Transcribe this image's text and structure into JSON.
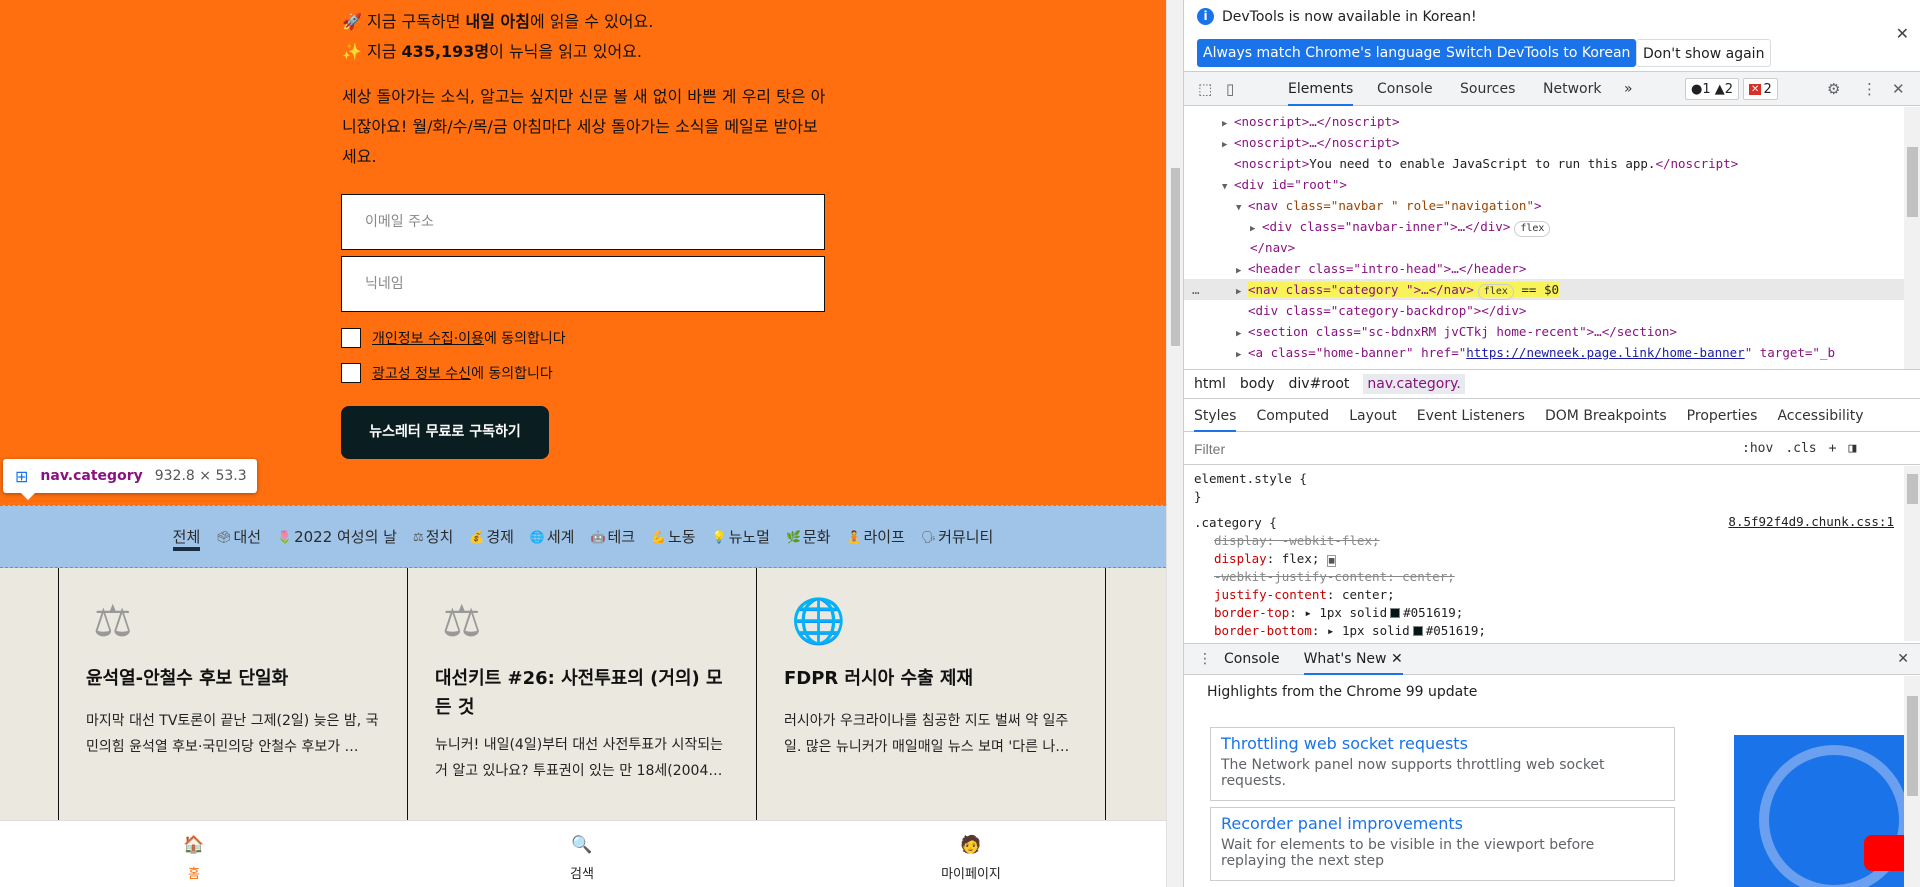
{
  "page": {
    "promo_line1_pre": "🚀 지금 구독하면 ",
    "promo_line1_bold": "내일 아침",
    "promo_line1_post": "에 읽을 수 있어요.",
    "promo_line2_pre": "✨ 지금 ",
    "promo_line2_bold": "435,193명",
    "promo_line2_post": "이 뉴닉을 읽고 있어요.",
    "description": "세상 돌아가는 소식, 알고는 싶지만 신문 볼 새 없이 바쁜 게 우리 탓은 아니잖아요! 월/화/수/목/금 아침마다 세상 돌아가는 소식을 메일로 받아보세요.",
    "email_placeholder": "이메일 주소",
    "nickname_placeholder": "닉네임",
    "consent1_link": "개인정보 수집·이용",
    "consent1_text": "에 동의합니다",
    "consent2_link": "광고성 정보 수신",
    "consent2_text": "에 동의합니다",
    "subscribe_button": "뉴스레터 무료로 구독하기",
    "inspect_tooltip": {
      "tag": "nav.category",
      "size": "932.8 × 53.3"
    },
    "categories": [
      {
        "icon": "",
        "label": "전체",
        "active": true
      },
      {
        "icon": "🗳",
        "label": "대선"
      },
      {
        "icon": "🌷",
        "label": "2022 여성의 날"
      },
      {
        "icon": "⚖",
        "label": "정치"
      },
      {
        "icon": "💰",
        "label": "경제"
      },
      {
        "icon": "🌐",
        "label": "세계"
      },
      {
        "icon": "🤖",
        "label": "테크"
      },
      {
        "icon": "💪",
        "label": "노동"
      },
      {
        "icon": "💡",
        "label": "뉴노멀"
      },
      {
        "icon": "🌿",
        "label": "문화"
      },
      {
        "icon": "🧘",
        "label": "라이프"
      },
      {
        "icon": "🗣",
        "label": "커뮤니티"
      }
    ],
    "cards": [
      {
        "icon": "⚖",
        "title": "윤석열-안철수 후보 단일화",
        "desc": "마지막 대선 TV토론이 끝난 그제(2일) 늦은 밤, 국민의힘 윤석열 후보·국민의당 안철수 후보가 …"
      },
      {
        "icon": "⚖",
        "title": "대선키트 #26: 사전투표의 (거의) 모든 것",
        "desc": "뉴니커! 내일(4일)부터 대선 사전투표가 시작되는 거 알고 있나요? 투표권이 있는 만 18세(2004…"
      },
      {
        "icon": "🌐",
        "title": "FDPR 러시아 수출 제재",
        "desc": "러시아가 우크라이나를 침공한 지도 벌써 약 일주일. 많은 뉴니커가 매일매일 뉴스 보며 '다른 나…"
      }
    ],
    "bottom_nav": [
      {
        "icon": "🏠",
        "label": "홈",
        "active": true
      },
      {
        "icon": "🔍",
        "label": "검색"
      },
      {
        "icon": "🧑",
        "label": "마이페이지"
      }
    ]
  },
  "devtools": {
    "infobar_message": "DevTools is now available in Korean!",
    "btn_match": "Always match Chrome's language",
    "btn_switch": "Switch DevTools to Korean",
    "btn_dont_show": "Don't show again",
    "tabs": [
      "Elements",
      "Console",
      "Sources",
      "Network"
    ],
    "more_tabs": "»",
    "badge_info": "1",
    "badge_warn": "2",
    "badge_err": "2",
    "dom_lines": {
      "l1": "<noscript>…</noscript>",
      "l2": "<noscript>…</noscript>",
      "l3_tag": "<noscript>",
      "l3_text": "You need to enable JavaScript to run this app.",
      "l3_end": "</noscript>",
      "l4": "<div id=\"root\">",
      "l5_open": "<nav ",
      "l5_attrs": "class=\"navbar \" role=\"navigation\"",
      "l5_close": ">",
      "l6": "<div class=\"navbar-inner\">…</div>",
      "l6_flex": "flex",
      "l7": "</nav>",
      "l8": "<header class=\"intro-head\">…</header>",
      "l9": "<nav class=\"category \">…</nav>",
      "l9_flex": "flex",
      "l9_eq": "== $0",
      "l10": "<div class=\"category-backdrop\"></div>",
      "l11": "<section class=\"sc-bdnxRM jvCTkj home-recent\">…</section>",
      "l12_open": "<a class=\"home-banner\" href=\"",
      "l12_href": "https://newneek.page.link/home-banner",
      "l12_close": "\" target=\"_b"
    },
    "breadcrumbs": [
      "html",
      "body",
      "div#root",
      "nav.category."
    ],
    "style_tabs": [
      "Styles",
      "Computed",
      "Layout",
      "Event Listeners",
      "DOM Breakpoints",
      "Properties",
      "Accessibility"
    ],
    "filter_placeholder": "Filter",
    "filter_hov": ":hov",
    "filter_cls": ".cls",
    "filter_plus": "+",
    "styles": {
      "element_style": "element.style {",
      "close": "}",
      "selector": ".category {",
      "source": "8.5f92f4d9.chunk.css:1",
      "d1": "display: -webkit-flex;",
      "d2_prop": "display",
      "d2_val": "flex;",
      "d3": "-webkit-justify-content: center;",
      "d4_prop": "justify-content",
      "d4_val": "center;",
      "d5_prop": "border-top",
      "d5_val": "1px solid",
      "d5_color": "#051619;",
      "d6_prop": "border-bottom",
      "d6_val": "1px solid",
      "d6_color": "#051619;"
    },
    "drawer_tabs": [
      "Console",
      "What's New"
    ],
    "whatsnew_heading": "Highlights from the Chrome 99 update",
    "features": [
      {
        "title": "Throttling web socket requests",
        "desc": "The Network panel now supports throttling web socket requests."
      },
      {
        "title": "Recorder panel improvements",
        "desc": "Wait for elements to be visible in the viewport before replaying the next step"
      }
    ]
  },
  "colors": {
    "brand_orange": "#ff6f0f",
    "category_highlight": "#a0c4e8",
    "devtools_blue": "#1a73e8"
  }
}
